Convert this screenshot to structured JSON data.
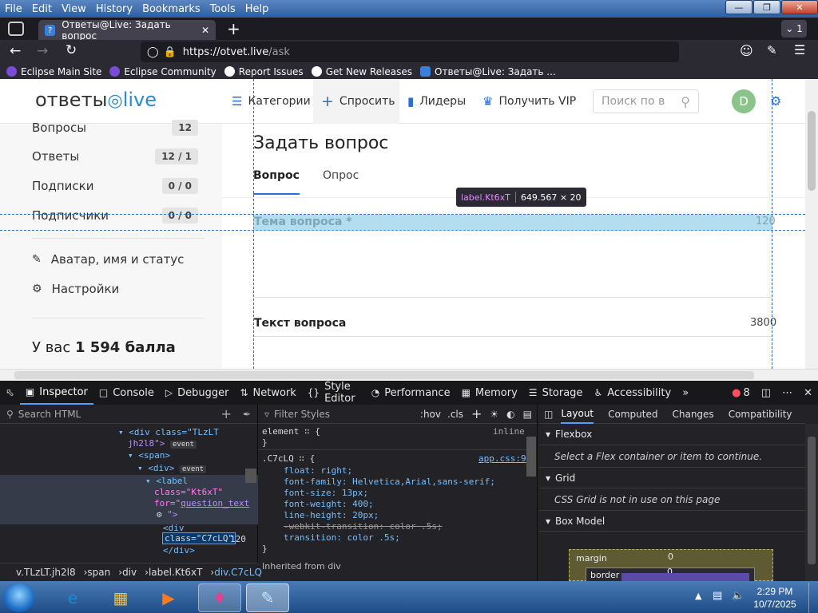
{
  "menubar": {
    "items": [
      "File",
      "Edit",
      "View",
      "History",
      "Bookmarks",
      "Tools",
      "Help"
    ]
  },
  "tabstrip": {
    "tab_title": "Ответы@Live: Задать вопрос",
    "tab_count": "1"
  },
  "navbar": {
    "url_host": "https://otvet.live",
    "url_path": "/ask"
  },
  "bookmarks": [
    {
      "label": "Eclipse Main Site",
      "color": "#7a4bd6"
    },
    {
      "label": "Eclipse Community",
      "color": "#7a4bd6"
    },
    {
      "label": "Report Issues",
      "color": "#ffffff"
    },
    {
      "label": "Get New Releases",
      "color": "#ffffff"
    },
    {
      "label": "Ответы@Live: Задать ...",
      "color": "#3b7fdc"
    }
  ],
  "site": {
    "logo_a": "ответы",
    "logo_b": "live",
    "nav": [
      "Категории",
      "Спросить",
      "Лидеры",
      "Получить VIP"
    ],
    "search_placeholder": "Поиск по в",
    "avatar_letter": "D"
  },
  "sidebar": {
    "stats": [
      {
        "label": "Вопросы",
        "count": "12"
      },
      {
        "label": "Ответы",
        "count": "12 / 1"
      },
      {
        "label": "Подписки",
        "count": "0 / 0"
      },
      {
        "label": "Подписчики",
        "count": "0 / 0"
      }
    ],
    "links": [
      "Аватар, имя и статус",
      "Настройки"
    ],
    "balls_prefix": "У вас",
    "balls_value": "1 594 балла"
  },
  "ask": {
    "title": "Задать вопрос",
    "tab_question": "Вопрос",
    "tab_poll": "Опрос",
    "topic_label": "Тема вопроса",
    "topic_required": "*",
    "topic_limit": "120",
    "text_label": "Текст вопроса",
    "text_limit": "3800"
  },
  "inspector_tooltip": {
    "tag": "label.Kt6xT",
    "size": "649.567 × 20"
  },
  "devtools": {
    "tabs": [
      "Inspector",
      "Console",
      "Debugger",
      "Network",
      "Style Editor",
      "Performance",
      "Memory",
      "Storage",
      "Accessibility"
    ],
    "error_count": "8",
    "search_html": "Search HTML",
    "filter_styles": "Filter Styles",
    "hov": ":hov",
    "cls": ".cls",
    "html_lines": {
      "l1a": "<div class=\"TLzLT",
      "l1b": "jh2l8\">",
      "l2": "<span>",
      "l3": "<div>",
      "l4": "<label",
      "l5": "class=\"Kt6xT\"",
      "l6a": "for=\"",
      "l6b": "question_text",
      "l7": "\">",
      "l8": "<div",
      "l9": "class=\"C7cLQ\"",
      "l9b": "120",
      "l10": "</div>",
      "event": "event"
    },
    "rules": {
      "element": "element",
      "inline": "inline",
      "selector": ".C7cLQ",
      "source": "app.css:9",
      "decls": [
        "float: right;",
        "font-family: Helvetica,Arial,sans-serif;",
        "font-size: 13px;",
        "font-weight: 400;",
        "line-height: 20px;",
        "-webkit-transition: color .5s;",
        "transition: color .5s;"
      ],
      "inherited": "Inherited from div"
    },
    "layout_tabs": [
      "Layout",
      "Computed",
      "Changes",
      "Compatibility"
    ],
    "flexbox": "Flexbox",
    "flex_note": "Select a Flex container or item to continue.",
    "grid": "Grid",
    "grid_note": "CSS Grid is not in use on this page",
    "box_model": "Box Model",
    "margin": "margin",
    "border": "border",
    "zero": "0",
    "crumbs": [
      "v.TLzLT.jh2l8",
      "span",
      "div",
      "label.Kt6xT",
      "div.C7cLQ"
    ]
  },
  "taskbar": {
    "time": "2:29 PM",
    "date": "10/7/2025"
  }
}
